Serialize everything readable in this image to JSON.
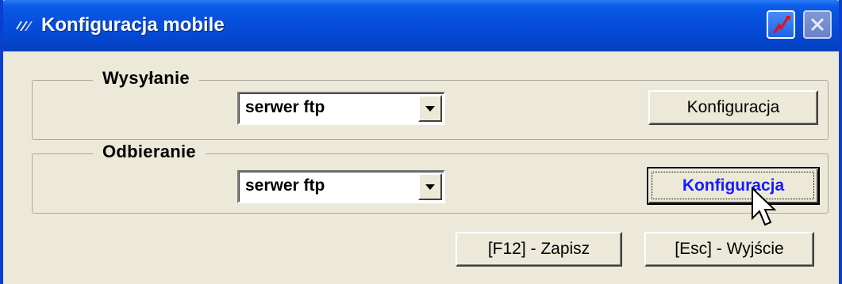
{
  "window": {
    "title": "Konfiguracja mobile",
    "titlebar_color": "#0548d2",
    "icons": {
      "app": "app-logo-icon",
      "mobile_button": "mobile-sync-icon",
      "close": "close-icon"
    }
  },
  "send_group": {
    "legend": "Wysyłanie",
    "method_select": {
      "selected": "serwer ftp"
    },
    "config_button": "Konfiguracja"
  },
  "receive_group": {
    "legend": "Odbieranie",
    "method_select": {
      "selected": "serwer ftp"
    },
    "config_button": "Konfiguracja"
  },
  "footer": {
    "save_button": "[F12] - Zapisz",
    "exit_button": "[Esc] - Wyjście"
  },
  "colors": {
    "dialog_bg": "#ece9d8",
    "focused_button_text": "#1a1aff"
  }
}
